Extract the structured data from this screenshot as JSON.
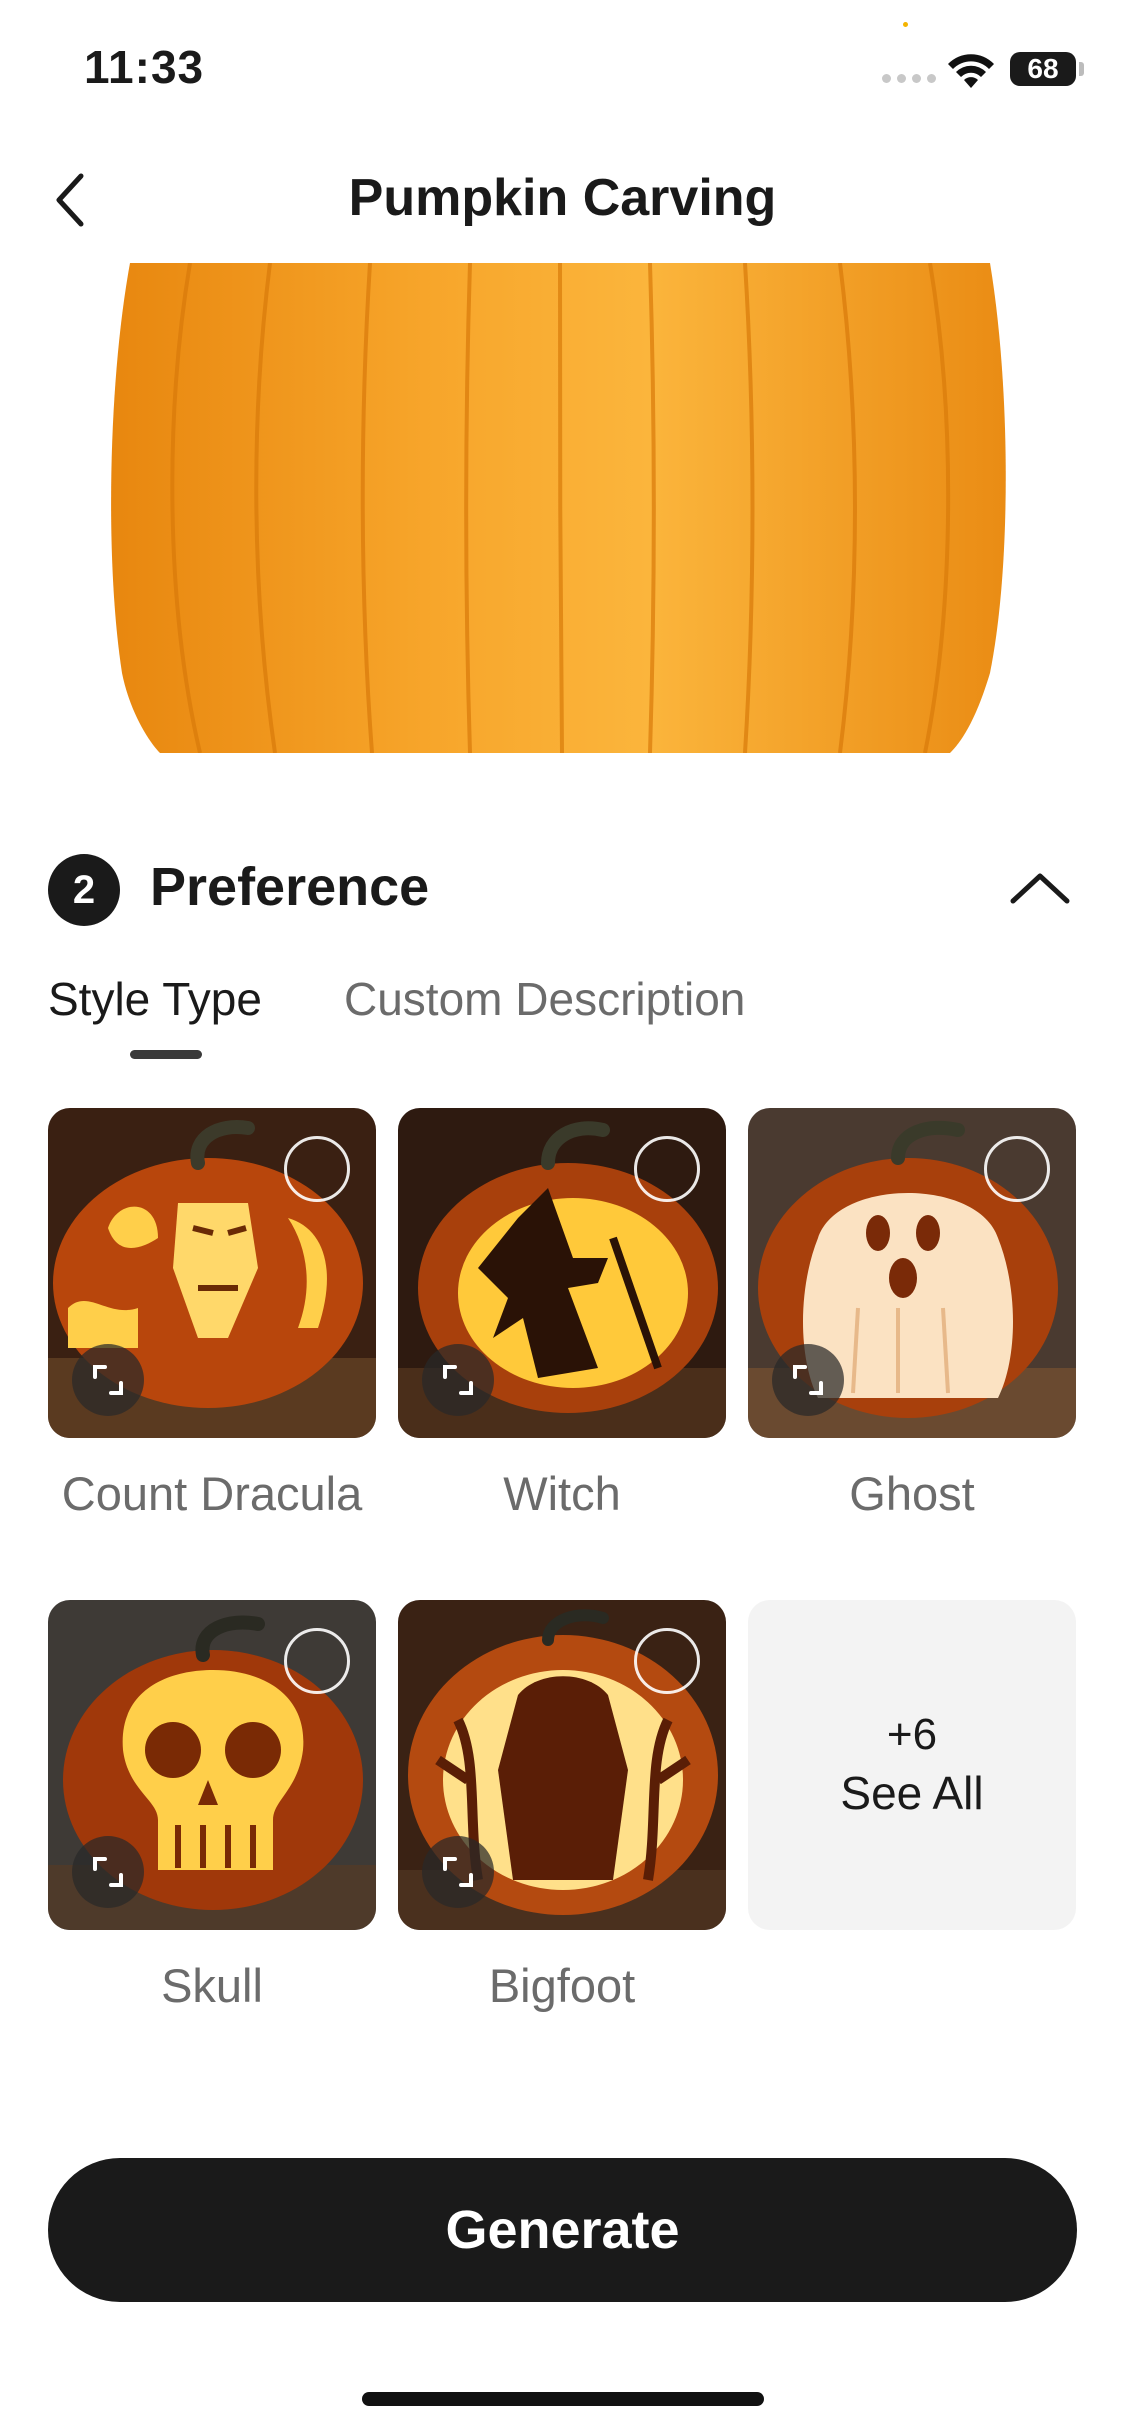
{
  "status_bar": {
    "time": "11:33",
    "battery": "68"
  },
  "header": {
    "title": "Pumpkin Carving"
  },
  "preference": {
    "step": "2",
    "title": "Preference"
  },
  "tabs": [
    {
      "label": "Style Type",
      "active": true
    },
    {
      "label": "Custom Description",
      "active": false
    }
  ],
  "styles": [
    {
      "label": "Count Dracula",
      "icon": "dracula-pumpkin"
    },
    {
      "label": "Witch",
      "icon": "witch-pumpkin"
    },
    {
      "label": "Ghost",
      "icon": "ghost-pumpkin"
    },
    {
      "label": "Skull",
      "icon": "skull-pumpkin"
    },
    {
      "label": "Bigfoot",
      "icon": "bigfoot-pumpkin"
    }
  ],
  "see_all": {
    "count": "+6",
    "label": "See All"
  },
  "generate_label": "Generate",
  "colors": {
    "accent": "#1a1a1a",
    "pumpkin": "#f39a1d",
    "glow": "#ffd35c"
  }
}
